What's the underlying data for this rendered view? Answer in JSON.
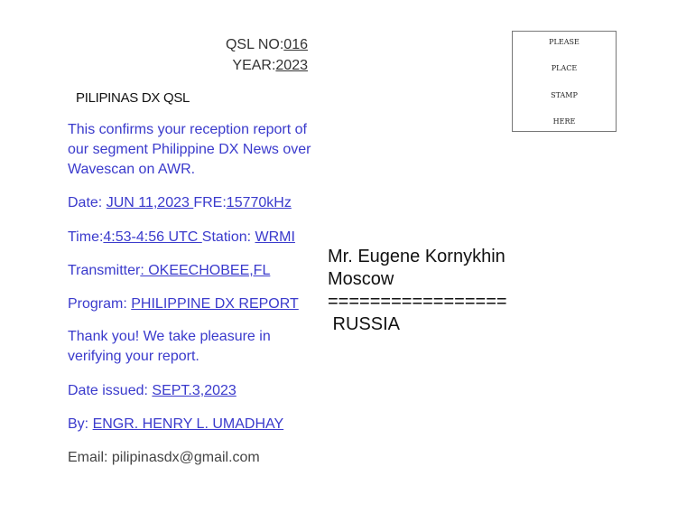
{
  "header": {
    "qsl_label": "QSL NO:",
    "qsl_no": "016",
    "year_label": "YEAR:",
    "year": "2023"
  },
  "title": "PILIPINAS DX  QSL",
  "confirmation": "This confirms your reception report of our segment Philippine DX News over Wavescan on AWR.",
  "date": {
    "label": "Date: ",
    "value": "JUN 11,2023 ",
    "fre_label": "FRE:",
    "fre_value": "15770kHz"
  },
  "time": {
    "label": "Time:",
    "value": "4:53-4:56 UTC ",
    "station_label": "Station: ",
    "station_value": "WRMI"
  },
  "transmitter": {
    "label": "Transmitter",
    "value": ": OKEECHOBEE,FL"
  },
  "program": {
    "label": "Program: ",
    "value": "PHILIPPINE DX REPORT"
  },
  "thanks": "Thank you! We take pleasure in verifying your report.",
  "issued": {
    "label": "Date issued: ",
    "value": "SEPT.3,2023"
  },
  "by": {
    "label": "By: ",
    "value": "ENGR. HENRY L. UMADHAY"
  },
  "email": "Email: pilipinasdx@gmail.com",
  "stamp": [
    "PLEASE",
    "PLACE",
    "STAMP",
    "HERE"
  ],
  "address": {
    "name": "Mr. Eugene Kornykhin",
    "city": "Moscow",
    "separator": "=================",
    "country": " RUSSIA"
  }
}
